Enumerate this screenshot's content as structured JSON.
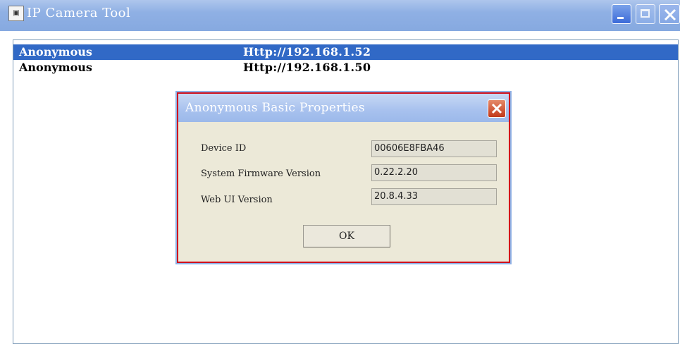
{
  "window": {
    "title": "IP Camera Tool",
    "icon": "camera-app-icon",
    "controls": [
      "minimize",
      "maximize",
      "close"
    ]
  },
  "device_list": [
    {
      "name": "Anonymous",
      "address": "Http://192.168.1.52",
      "selected": true
    },
    {
      "name": "Anonymous",
      "address": "Http://192.168.1.50",
      "selected": false
    }
  ],
  "dialog": {
    "title": "Anonymous Basic Properties",
    "properties": [
      {
        "label": "Device ID",
        "value": "00606E8FBA46"
      },
      {
        "label": "System Firmware Version",
        "value": "0.22.2.20"
      },
      {
        "label": "Web UI Version",
        "value": "20.8.4.33"
      }
    ],
    "ok_label": "OK"
  },
  "colors": {
    "titlebar": "#8fb0e4",
    "selection": "#3169c6",
    "dialog_border": "#d0101c",
    "dialog_body": "#ece9d8",
    "close_button": "#c2391b"
  }
}
